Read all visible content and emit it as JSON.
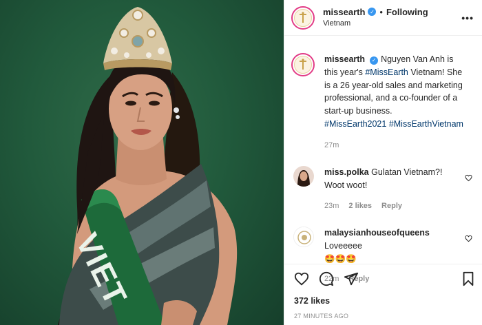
{
  "header": {
    "username": "missearth",
    "follow_label": "Following",
    "location": "Vietnam",
    "more_label": "•••"
  },
  "caption": {
    "username": "missearth",
    "text_1": "Nguyen Van Anh is this year's ",
    "tag_1": "#MissEarth",
    "text_2": " Vietnam! She is a 26 year-old sales and marketing professional, and a co-founder of a start-up business.",
    "tag_2": "#MissEarth2021",
    "tag_3": "#MissEarthVietnam",
    "time": "27m"
  },
  "comments": [
    {
      "username": "miss.polka",
      "text": "Gulatan Vietnam?! Woot woot!",
      "time": "23m",
      "likes": "2 likes",
      "reply": "Reply"
    },
    {
      "username": "malaysianhouseofqueens",
      "text": "Loveeeee",
      "emoji": "🤩🤩🤩",
      "time": "22m",
      "reply": "Reply"
    }
  ],
  "photo": {
    "sash_text": "VIET"
  },
  "footer": {
    "likes": "372 likes",
    "ago": "27 MINUTES AGO"
  },
  "colors": {
    "accent_link": "#00376b",
    "verified": "#3897f0",
    "story_ring": "#e23c86",
    "photo_background": "#215a3c"
  },
  "icons": [
    "verified-badge-icon",
    "heart-icon",
    "comment-icon",
    "share-icon",
    "bookmark-icon"
  ]
}
